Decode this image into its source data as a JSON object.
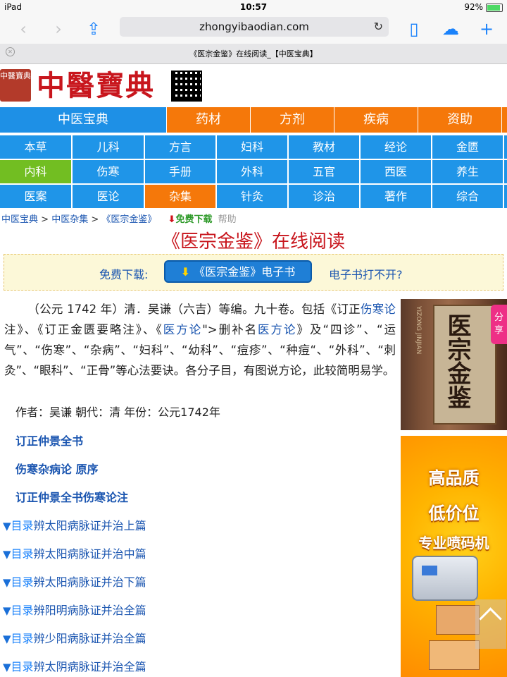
{
  "status_bar": {
    "device": "iPad",
    "time": "10:57",
    "battery": "92%"
  },
  "browser": {
    "url": "zhongyibaodian.com",
    "tab_title": "《医宗金鉴》在线阅读_【中医宝典】"
  },
  "logo": {
    "seal_text": "中醫寶典",
    "title": "中醫寶典"
  },
  "main_nav": [
    {
      "label": "中医宝典"
    },
    {
      "label": "药材"
    },
    {
      "label": "方剂"
    },
    {
      "label": "疾病"
    },
    {
      "label": "资助"
    }
  ],
  "category_rows": [
    [
      "本草",
      "儿科",
      "方言",
      "妇科",
      "教材",
      "经论",
      "金匮"
    ],
    [
      "内科",
      "伤寒",
      "手册",
      "外科",
      "五官",
      "西医",
      "养生"
    ],
    [
      "医案",
      "医论",
      "杂集",
      "针灸",
      "诊治",
      "著作",
      "综合"
    ]
  ],
  "breadcrumb": {
    "home": "中医宝典",
    "sep1": " > ",
    "section": "中医杂集",
    "sep2": " > ",
    "current": "《医宗金鉴》",
    "download": "免费下载",
    "help": "帮助"
  },
  "page_title": "《医宗金鉴》在线阅读",
  "download_box": {
    "label": "免费下载:",
    "button": "《医宗金鉴》电子书",
    "help": "电子书打不开?"
  },
  "intro": {
    "p1": "（公元 1742 年）清．吴谦（六吉）等编。九十卷。包括《订正",
    "lk1": "伤寒论",
    "p2": "注》、《订正金匮要略注》、《",
    "lk2": "医方论",
    "p3": "\">删补名",
    "lk3": "医方论",
    "p4": "》及“四诊”、“运气”、“伤寒”、“杂病”、“妇科”、“幼科”、“痘疹”、“种痘“、“外科”、“刺灸”、“眼科”、“正骨”等心法要诀。各分子目，有图说方论，此较简明易学。"
  },
  "meta": "作者：吴谦 朝代：清 年份：公元1742年",
  "links": [
    "订正仲景全书",
    "伤寒杂病论 原序",
    "订正仲景全书伤寒论注"
  ],
  "toc": {
    "tag": "目录",
    "items": [
      "辨太阳病脉证并治上篇",
      "辨太阳病脉证并治中篇",
      "辨太阳病脉证并治下篇",
      "辨阳明病脉证并治全篇",
      "辨少阳病脉证并治全篇",
      "辨太阴病脉证并治全篇"
    ]
  },
  "book_cover": {
    "spine": "YIZONG JINJIAN",
    "title": "医宗金鉴"
  },
  "share": "分享",
  "ad": {
    "line1": "高品质",
    "line2": "低价位",
    "line3": "专业喷码机"
  },
  "colors": {
    "orange": "#f5780a",
    "blue": "#1f95e8",
    "green": "#72be22",
    "title_red": "#c8161d",
    "link": "#1a55b0"
  }
}
